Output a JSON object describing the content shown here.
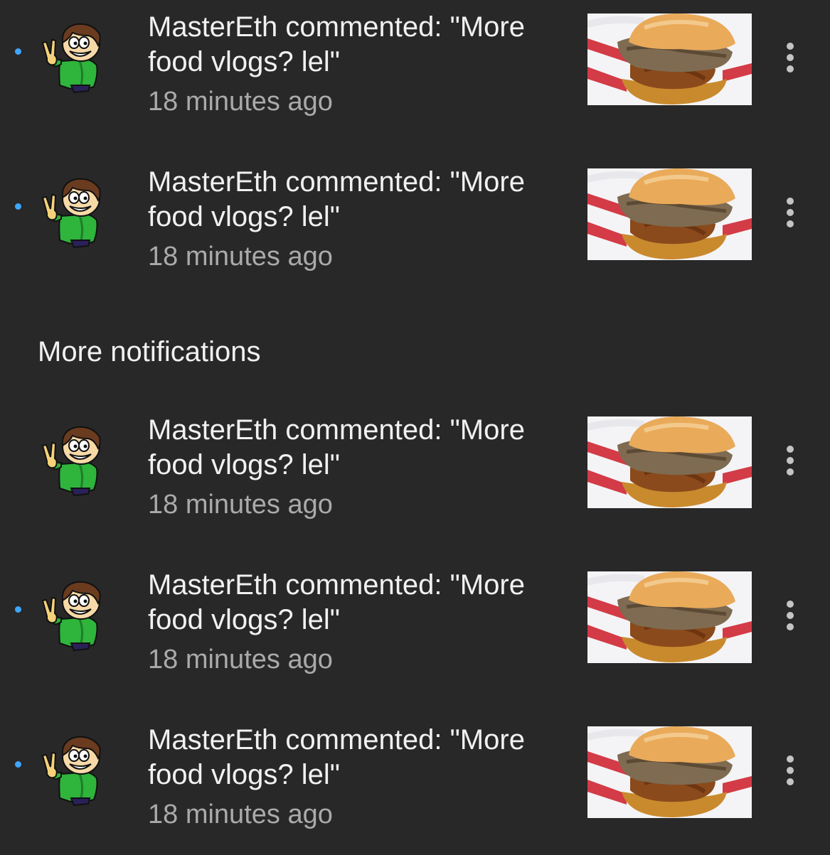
{
  "section_title": "More notifications",
  "colors": {
    "background": "#282828",
    "unread_dot": "#3ea6ff",
    "primary_text": "#f1f1f1",
    "secondary_text": "#aaaaaa"
  },
  "notifications": [
    {
      "comment_line1": "MasterEth commented: \"More",
      "comment_line2": "food vlogs? lel\"",
      "time": "18 minutes ago",
      "unread": true,
      "avatar_icon": "cartoon-avatar-icon",
      "thumbnail": "sandwich-thumbnail"
    },
    {
      "comment_line1": "MasterEth commented: \"More",
      "comment_line2": "food vlogs? lel\"",
      "time": "18 minutes ago",
      "unread": true,
      "avatar_icon": "cartoon-avatar-icon",
      "thumbnail": "sandwich-thumbnail"
    },
    {
      "comment_line1": "MasterEth commented: \"More",
      "comment_line2": "food vlogs? lel\"",
      "time": "18 minutes ago",
      "unread": false,
      "avatar_icon": "cartoon-avatar-icon",
      "thumbnail": "sandwich-thumbnail"
    },
    {
      "comment_line1": "MasterEth commented: \"More",
      "comment_line2": "food vlogs? lel\"",
      "time": "18 minutes ago",
      "unread": true,
      "avatar_icon": "cartoon-avatar-icon",
      "thumbnail": "sandwich-thumbnail"
    },
    {
      "comment_line1": "MasterEth commented: \"More",
      "comment_line2": "food vlogs? lel\"",
      "time": "18 minutes ago",
      "unread": true,
      "avatar_icon": "cartoon-avatar-icon",
      "thumbnail": "sandwich-thumbnail"
    }
  ],
  "menu_icon": "more-vertical-icon"
}
